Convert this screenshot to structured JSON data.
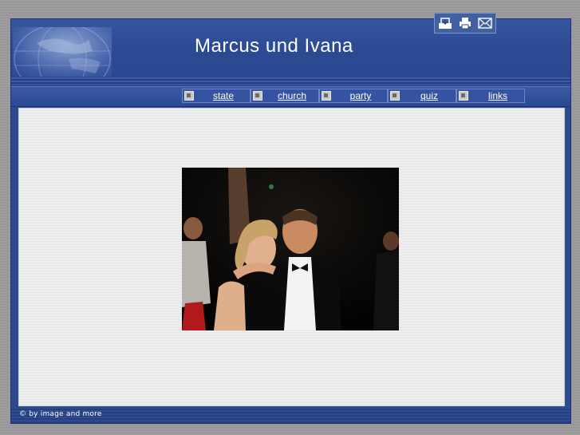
{
  "header": {
    "title": "Marcus und Ivana"
  },
  "toolbar": {
    "icons": [
      "download-icon",
      "print-icon",
      "mail-icon"
    ]
  },
  "nav": {
    "items": [
      {
        "label": "state"
      },
      {
        "label": "church"
      },
      {
        "label": "party"
      },
      {
        "label": "quiz"
      },
      {
        "label": "links"
      }
    ]
  },
  "footer": {
    "copyright": "© by image and more"
  },
  "colors": {
    "frame": "#2e4a8f",
    "content_bg": "#e6e6e8",
    "page_bg": "#9c9a9c"
  }
}
